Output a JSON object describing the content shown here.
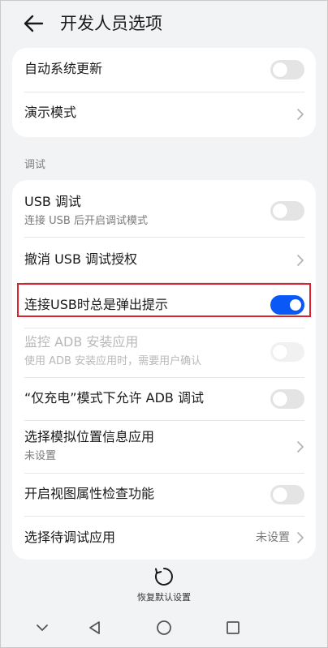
{
  "header": {
    "title": "开发人员选项"
  },
  "card_top": {
    "items": [
      {
        "label": "自动系统更新",
        "control": "toggle",
        "state": "off"
      },
      {
        "label": "演示模式",
        "control": "chevron"
      }
    ]
  },
  "debug_section": {
    "label": "调试",
    "items": [
      {
        "label": "USB 调试",
        "subtitle": "连接 USB 后开启调试模式",
        "control": "toggle",
        "state": "off"
      },
      {
        "label": "撤消 USB 调试授权",
        "control": "chevron"
      },
      {
        "label": "连接USB时总是弹出提示",
        "control": "toggle",
        "state": "on"
      },
      {
        "label": "监控 ADB 安装应用",
        "subtitle": "使用 ADB 安装应用时，需要用户确认",
        "control": "toggle",
        "state": "disabled"
      },
      {
        "label": "“仅充电”模式下允许 ADB 调试",
        "control": "toggle",
        "state": "off"
      },
      {
        "label": "选择模拟位置信息应用",
        "subtitle": "未设置",
        "control": "chevron"
      },
      {
        "label": "开启视图属性检查功能",
        "control": "toggle",
        "state": "off"
      },
      {
        "label": "选择待调试应用",
        "value": "未设置",
        "control": "chevron"
      }
    ]
  },
  "footer": {
    "reset_label": "恢复默认设置"
  },
  "colors": {
    "accent": "#0a59f7",
    "highlight": "#d9242f",
    "background": "#f1f3f5"
  }
}
